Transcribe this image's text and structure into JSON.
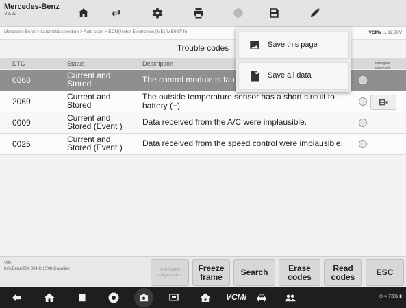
{
  "app": {
    "title": "Mercedes-Benz",
    "version": "V2.20"
  },
  "toolbar": {
    "icons": [
      "home-icon",
      "vehicle-swap-icon",
      "settings-icon",
      "print-icon",
      "help-icon",
      "save-icon",
      "edit-icon"
    ]
  },
  "breadcrumb": {
    "path": "Mercedes-Benz > Automatic selection > Auto scan > ECM(Motor Electronics (ME) 'ME097' fo",
    "vcm_label": "VCMs",
    "voltage": "12.78V"
  },
  "page": {
    "title": "Trouble codes"
  },
  "table": {
    "headers": [
      "DTC",
      "Status",
      "Description",
      "",
      "Intelligent diagnostic"
    ],
    "rows": [
      {
        "code": "0868",
        "status": "Current and Stored",
        "description": "The control module is fau",
        "selected": true
      },
      {
        "code": "2069",
        "status": "Current and Stored",
        "description": "The outside temperature sensor has a short circuit to battery (+).",
        "selected": false
      },
      {
        "code": "0009",
        "status": "Current and Stored (Event )",
        "description": "Data received from the A/C were implausible.",
        "selected": false
      },
      {
        "code": "0025",
        "status": "Current and Stored (Event )",
        "description": "Data received from the speed control were implausible.",
        "selected": false
      }
    ]
  },
  "popup_menu": {
    "items": [
      {
        "label": "Save this page",
        "icon": "image-icon"
      },
      {
        "label": "Save all data",
        "icon": "pdf-icon"
      }
    ]
  },
  "footer": {
    "vin_label": "VIN",
    "vehicle_info": "Info:Benz/204.054 C (204) Gasoline",
    "buttons": {
      "intelligent": "Intelligent diagnostics",
      "freeze": "Freeze frame",
      "search": "Search",
      "erase": "Erase codes",
      "read": "Read codes",
      "esc": "ESC"
    }
  },
  "android_nav": {
    "vcm_text": "VCMi",
    "status": "73%"
  },
  "colors": {
    "selected_row": "#8f8f8f",
    "background": "#f2f2f2",
    "navbar": "#1e1e1e"
  }
}
